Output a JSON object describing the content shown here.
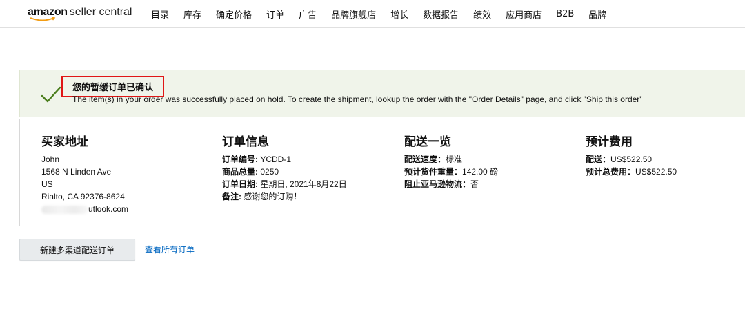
{
  "header": {
    "brand": "amazon",
    "brand_sub": "seller central",
    "nav": [
      "目录",
      "库存",
      "确定价格",
      "订单",
      "广告",
      "品牌旗舰店",
      "增长",
      "数据报告",
      "绩效",
      "应用商店",
      "B2B",
      "品牌"
    ]
  },
  "banner": {
    "title": "您的暂缓订单已确认",
    "message": "The item(s) in your order was successfully placed on hold. To create the shipment, lookup the order with the \"Order Details\" page, and click \"Ship this order\""
  },
  "buyer_address": {
    "heading": "买家地址",
    "name": "John",
    "street": "1568 N Linden Ave",
    "country": "US",
    "city": "Rialto, CA 92376-8624",
    "email_visible": "utlook.com"
  },
  "order_info": {
    "heading": "订单信息",
    "order_number_label": "订单编号:",
    "order_number": "YCDD-1",
    "total_label": "商品总量:",
    "total": "0250",
    "date_label": "订单日期:",
    "date": "星期日, 2021年8月22日",
    "note_label": "备注:",
    "note": "感谢您的订购！"
  },
  "shipping": {
    "heading": "配送一览",
    "speed_label": "配送速度：",
    "speed": "标准",
    "weight_label": "预计货件重量：",
    "weight": "142.00 磅",
    "block_label": "阻止亚马逊物流：",
    "block": "否"
  },
  "fees": {
    "heading": "预计费用",
    "shipping_label": "配送：",
    "shipping": "US$522.50",
    "total_label": "预计总费用：",
    "total": "US$522.50"
  },
  "actions": {
    "new_order_button": "新建多渠道配送订单",
    "view_all_link": "查看所有订单"
  },
  "colors": {
    "accent_link": "#0066c0",
    "success_green": "#4a7d1c",
    "highlight_red": "#e01616",
    "banner_bg": "#f0f4ea"
  }
}
